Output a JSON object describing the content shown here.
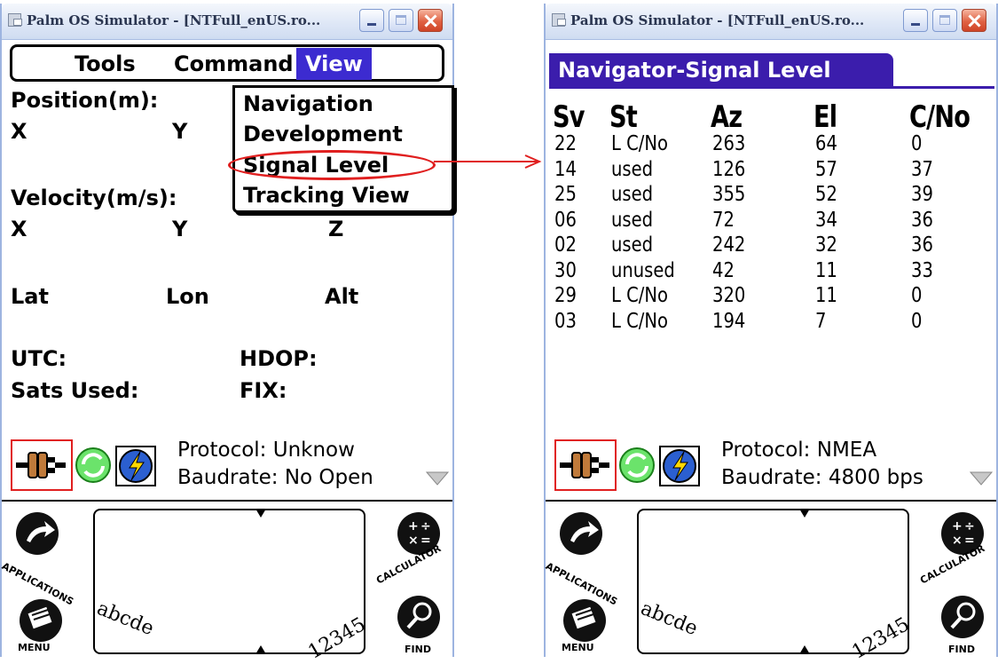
{
  "left_window": {
    "title": "Palm OS Simulator - [NTFull_enUS.ro...",
    "menubar": {
      "tools": "Tools",
      "command": "Command",
      "view": "View"
    },
    "dropdown": [
      "Navigation",
      "Development",
      "Signal Level",
      "Tracking View"
    ],
    "labels": {
      "position": "Position(m):",
      "pos_x": "X",
      "pos_y": "Y",
      "velocity": "Velocity(m/s):",
      "vel_x": "X",
      "vel_y": "Y",
      "vel_z": "Z",
      "lat": "Lat",
      "lon": "Lon",
      "alt": "Alt",
      "utc": "UTC:",
      "hdop": "HDOP:",
      "sats_used": "Sats Used:",
      "fix": "FIX:"
    },
    "status": {
      "protocol": "Protocol:  Unknow",
      "baudrate": "Baudrate: No Open"
    }
  },
  "right_window": {
    "title": "Palm OS Simulator - [NTFull_enUS.ro...",
    "screen_title": "Navigator-Signal Level",
    "table_headers": [
      "Sv",
      "St",
      "Az",
      "El",
      "C/No"
    ],
    "rows": [
      [
        "22",
        "L C/No",
        "263",
        "64",
        "0"
      ],
      [
        "14",
        "used",
        "126",
        "57",
        "37"
      ],
      [
        "25",
        "used",
        "355",
        "52",
        "39"
      ],
      [
        "06",
        "used",
        "72",
        "34",
        "36"
      ],
      [
        "02",
        "used",
        "242",
        "32",
        "36"
      ],
      [
        "30",
        "unused",
        "42",
        "11",
        "33"
      ],
      [
        "29",
        "L C/No",
        "320",
        "11",
        "0"
      ],
      [
        "03",
        "L C/No",
        "194",
        "7",
        "0"
      ]
    ],
    "status": {
      "protocol": "Protocol:  NMEA",
      "baudrate": "Baudrate: 4800 bps"
    }
  },
  "silkscreen": {
    "applications": "APPLICATIONS",
    "calculator": "CALCULATOR",
    "menu": "MENU",
    "find": "FIND",
    "letters": "abcde",
    "numbers": "12345"
  },
  "colors": {
    "menu_highlight": "#3c2bd0",
    "screen_title_bg": "#3b1dac",
    "annotation_red": "#e01f1f",
    "close_button": "#e06243"
  }
}
